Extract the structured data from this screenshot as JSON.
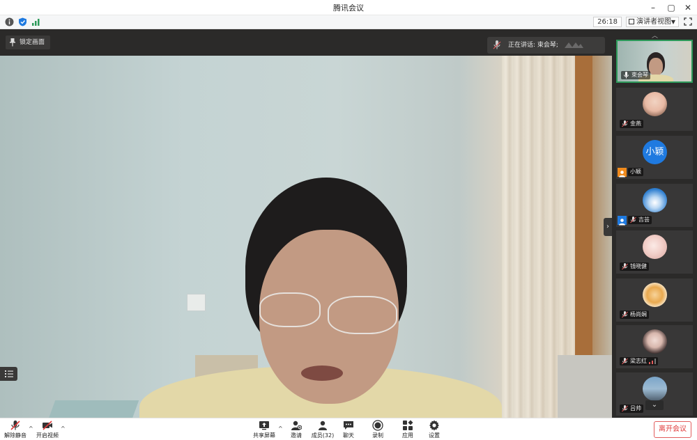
{
  "window": {
    "title": "腾讯会议"
  },
  "toolbar": {
    "timer": "26:18",
    "view_mode": "演讲者视图"
  },
  "stage": {
    "lock_label": "锁定画面",
    "speaking_label": "正在讲话: 束会琴;"
  },
  "participants": [
    {
      "name": "束会琴",
      "avatar": "camera-video",
      "active": true
    },
    {
      "name": "金燕",
      "avatar": "baby-photo-avatar"
    },
    {
      "name": "小颖",
      "avatar_text": "小颖",
      "avatar_color": "#1f7ae0",
      "badge": "host"
    },
    {
      "name": "吉芸",
      "avatar": "sky-avatar",
      "badge": "cohost"
    },
    {
      "name": "钱晓健",
      "avatar": "cartoon-avatar"
    },
    {
      "name": "杨尚娴",
      "avatar": "lion-avatar"
    },
    {
      "name": "梁志红",
      "avatar": "woman-photo-avatar",
      "signal": true
    },
    {
      "name": "吕帅",
      "avatar": "city-avatar"
    }
  ],
  "bottombar": {
    "unmute": "解除静音",
    "start_video": "开启视频",
    "share_screen": "共享屏幕",
    "invite": "邀请",
    "members": "成员(32)",
    "chat": "聊天",
    "record": "录制",
    "apps": "应用",
    "settings": "设置",
    "leave": "离开会议"
  },
  "colors": {
    "accent_green": "#2d9a5a",
    "leave_red": "#e03a3a",
    "stage_bg": "#2b2a29"
  }
}
